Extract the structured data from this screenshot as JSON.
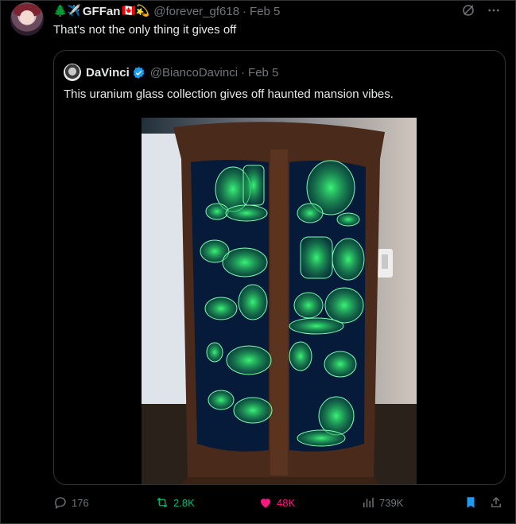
{
  "tweet": {
    "author": {
      "name": "GFFan",
      "emoji_prefix": "🌲✈️",
      "emoji_suffix": "🇨🇦💫",
      "handle": "@forever_gf618",
      "date": "Feb 5"
    },
    "text": "That's not the only thing it gives off",
    "quote": {
      "author_name": "DaVinci",
      "verified": true,
      "handle": "@BiancoDavinci",
      "date": "Feb 5",
      "text": "This uranium glass collection gives off haunted mansion vibes."
    },
    "stats": {
      "replies": "176",
      "retweets": "2.8K",
      "likes": "48K",
      "views": "739K"
    }
  },
  "colors": {
    "background": "#000000",
    "border": "#2f3336",
    "muted": "#71767b",
    "text": "#e7e9ea",
    "retweet_green": "#00ba7c",
    "like_pink": "#f91880",
    "bookmark_blue": "#1d9bf0",
    "glass_green": "#2cff6e"
  },
  "icons": [
    "grok-icon",
    "more-icon",
    "reply-icon",
    "retweet-icon",
    "heart-icon",
    "views-icon",
    "bookmark-icon",
    "share-icon",
    "verified-icon"
  ]
}
